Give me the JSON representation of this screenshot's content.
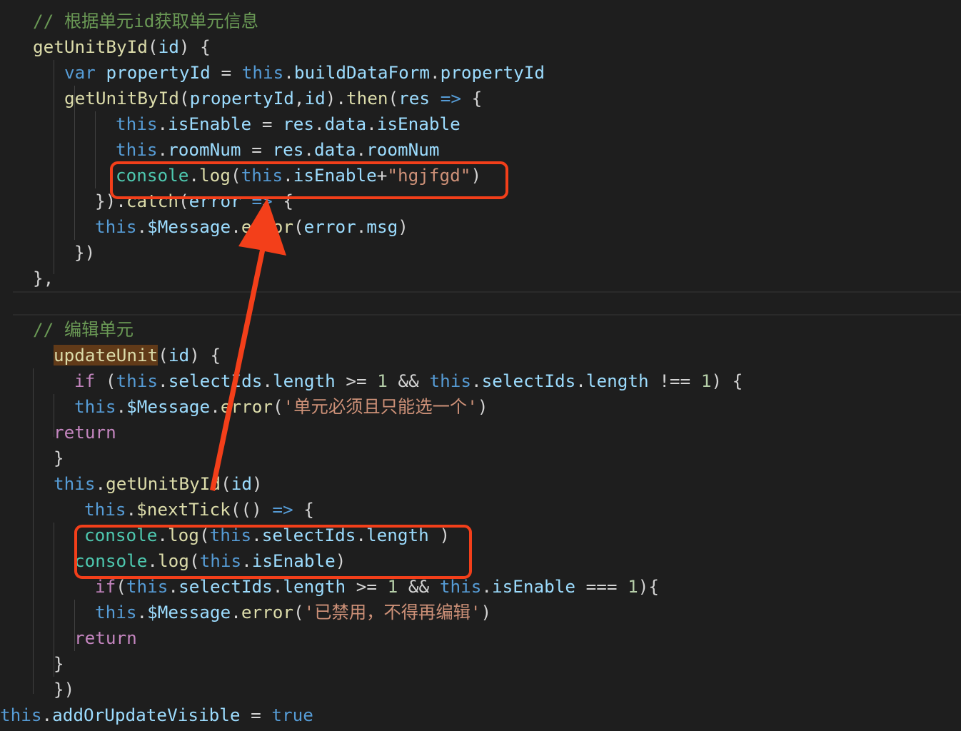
{
  "editor": {
    "colors": {
      "background": "#1e1e1e",
      "comment": "#6a9955",
      "keyword": "#569cd6",
      "control": "#c586c0",
      "function": "#dcdcaa",
      "variable": "#9cdcfe",
      "class": "#4ec9b0",
      "string": "#ce9178",
      "number": "#b5cea8",
      "plain": "#d4d4d4",
      "word_highlight": "#613a18",
      "annotation": "#f33f1a"
    },
    "lines": [
      [
        {
          "t": "// 根据单元id获取单元信息",
          "k": "comment"
        }
      ],
      [
        {
          "t": "getUnitById",
          "k": "function"
        },
        {
          "t": "(",
          "k": "plain"
        },
        {
          "t": "id",
          "k": "variable"
        },
        {
          "t": ") {",
          "k": "plain"
        }
      ],
      [
        {
          "t": "var",
          "k": "keyword"
        },
        {
          "t": " ",
          "k": "plain"
        },
        {
          "t": "propertyId",
          "k": "variable"
        },
        {
          "t": " = ",
          "k": "plain"
        },
        {
          "t": "this",
          "k": "keyword"
        },
        {
          "t": ".",
          "k": "plain"
        },
        {
          "t": "buildDataForm",
          "k": "variable"
        },
        {
          "t": ".",
          "k": "plain"
        },
        {
          "t": "propertyId",
          "k": "variable"
        }
      ],
      [
        {
          "t": "getUnitById",
          "k": "function"
        },
        {
          "t": "(",
          "k": "plain"
        },
        {
          "t": "propertyId",
          "k": "variable"
        },
        {
          "t": ",",
          "k": "plain"
        },
        {
          "t": "id",
          "k": "variable"
        },
        {
          "t": ").",
          "k": "plain"
        },
        {
          "t": "then",
          "k": "function"
        },
        {
          "t": "(",
          "k": "plain"
        },
        {
          "t": "res",
          "k": "variable"
        },
        {
          "t": " ",
          "k": "plain"
        },
        {
          "t": "=>",
          "k": "keyword"
        },
        {
          "t": " {",
          "k": "plain"
        }
      ],
      [
        {
          "t": "this",
          "k": "keyword"
        },
        {
          "t": ".",
          "k": "plain"
        },
        {
          "t": "isEnable",
          "k": "variable"
        },
        {
          "t": " = ",
          "k": "plain"
        },
        {
          "t": "res",
          "k": "variable"
        },
        {
          "t": ".",
          "k": "plain"
        },
        {
          "t": "data",
          "k": "variable"
        },
        {
          "t": ".",
          "k": "plain"
        },
        {
          "t": "isEnable",
          "k": "variable"
        }
      ],
      [
        {
          "t": "this",
          "k": "keyword"
        },
        {
          "t": ".",
          "k": "plain"
        },
        {
          "t": "roomNum",
          "k": "variable"
        },
        {
          "t": " = ",
          "k": "plain"
        },
        {
          "t": "res",
          "k": "variable"
        },
        {
          "t": ".",
          "k": "plain"
        },
        {
          "t": "data",
          "k": "variable"
        },
        {
          "t": ".",
          "k": "plain"
        },
        {
          "t": "roomNum",
          "k": "variable"
        }
      ],
      [
        {
          "t": "console",
          "k": "class"
        },
        {
          "t": ".",
          "k": "plain"
        },
        {
          "t": "log",
          "k": "function"
        },
        {
          "t": "(",
          "k": "plain"
        },
        {
          "t": "this",
          "k": "keyword"
        },
        {
          "t": ".",
          "k": "plain"
        },
        {
          "t": "isEnable",
          "k": "variable"
        },
        {
          "t": "+",
          "k": "plain"
        },
        {
          "t": "\"hgjfgd\"",
          "k": "string"
        },
        {
          "t": ")",
          "k": "plain"
        }
      ],
      [
        {
          "t": "}).",
          "k": "plain"
        },
        {
          "t": "catch",
          "k": "function"
        },
        {
          "t": "(",
          "k": "plain"
        },
        {
          "t": "error",
          "k": "variable"
        },
        {
          "t": " ",
          "k": "plain"
        },
        {
          "t": "=>",
          "k": "keyword"
        },
        {
          "t": " {",
          "k": "plain"
        }
      ],
      [
        {
          "t": "this",
          "k": "keyword"
        },
        {
          "t": ".",
          "k": "plain"
        },
        {
          "t": "$Message",
          "k": "variable"
        },
        {
          "t": ".",
          "k": "plain"
        },
        {
          "t": "error",
          "k": "function"
        },
        {
          "t": "(",
          "k": "plain"
        },
        {
          "t": "error",
          "k": "variable"
        },
        {
          "t": ".",
          "k": "plain"
        },
        {
          "t": "msg",
          "k": "variable"
        },
        {
          "t": ")",
          "k": "plain"
        }
      ],
      [
        {
          "t": "})",
          "k": "plain"
        }
      ],
      [
        {
          "t": "},",
          "k": "plain"
        }
      ],
      [
        {
          "t": "// 编辑单元",
          "k": "comment"
        }
      ],
      [
        {
          "t": "updateUnit",
          "k": "function",
          "hl": true
        },
        {
          "t": "(",
          "k": "plain"
        },
        {
          "t": "id",
          "k": "variable"
        },
        {
          "t": ") {",
          "k": "plain"
        }
      ],
      [
        {
          "t": "if",
          "k": "control"
        },
        {
          "t": " (",
          "k": "plain"
        },
        {
          "t": "this",
          "k": "keyword"
        },
        {
          "t": ".",
          "k": "plain"
        },
        {
          "t": "selectIds",
          "k": "variable"
        },
        {
          "t": ".",
          "k": "plain"
        },
        {
          "t": "length",
          "k": "variable"
        },
        {
          "t": " >= ",
          "k": "plain"
        },
        {
          "t": "1",
          "k": "number"
        },
        {
          "t": " && ",
          "k": "plain"
        },
        {
          "t": "this",
          "k": "keyword"
        },
        {
          "t": ".",
          "k": "plain"
        },
        {
          "t": "selectIds",
          "k": "variable"
        },
        {
          "t": ".",
          "k": "plain"
        },
        {
          "t": "length",
          "k": "variable"
        },
        {
          "t": " !== ",
          "k": "plain"
        },
        {
          "t": "1",
          "k": "number"
        },
        {
          "t": ") {",
          "k": "plain"
        }
      ],
      [
        {
          "t": "this",
          "k": "keyword"
        },
        {
          "t": ".",
          "k": "plain"
        },
        {
          "t": "$Message",
          "k": "variable"
        },
        {
          "t": ".",
          "k": "plain"
        },
        {
          "t": "error",
          "k": "function"
        },
        {
          "t": "(",
          "k": "plain"
        },
        {
          "t": "'单元必须且只能选一个'",
          "k": "string"
        },
        {
          "t": ")",
          "k": "plain"
        }
      ],
      [
        {
          "t": "return",
          "k": "control"
        }
      ],
      [
        {
          "t": "}",
          "k": "plain"
        }
      ],
      [
        {
          "t": "this",
          "k": "keyword"
        },
        {
          "t": ".",
          "k": "plain"
        },
        {
          "t": "getUnitById",
          "k": "function"
        },
        {
          "t": "(",
          "k": "plain"
        },
        {
          "t": "id",
          "k": "variable"
        },
        {
          "t": ")",
          "k": "plain"
        }
      ],
      [
        {
          "t": "this",
          "k": "keyword"
        },
        {
          "t": ".",
          "k": "plain"
        },
        {
          "t": "$nextTick",
          "k": "function"
        },
        {
          "t": "(() ",
          "k": "plain"
        },
        {
          "t": "=>",
          "k": "keyword"
        },
        {
          "t": " {",
          "k": "plain"
        }
      ],
      [
        {
          "t": "console",
          "k": "class"
        },
        {
          "t": ".",
          "k": "plain"
        },
        {
          "t": "log",
          "k": "function"
        },
        {
          "t": "(",
          "k": "plain"
        },
        {
          "t": "this",
          "k": "keyword"
        },
        {
          "t": ".",
          "k": "plain"
        },
        {
          "t": "selectIds",
          "k": "variable"
        },
        {
          "t": ".",
          "k": "plain"
        },
        {
          "t": "length",
          "k": "variable"
        },
        {
          "t": " )",
          "k": "plain"
        }
      ],
      [
        {
          "t": "console",
          "k": "class"
        },
        {
          "t": ".",
          "k": "plain"
        },
        {
          "t": "log",
          "k": "function"
        },
        {
          "t": "(",
          "k": "plain"
        },
        {
          "t": "this",
          "k": "keyword"
        },
        {
          "t": ".",
          "k": "plain"
        },
        {
          "t": "isEnable",
          "k": "variable"
        },
        {
          "t": ")",
          "k": "plain"
        }
      ],
      [
        {
          "t": "if",
          "k": "control"
        },
        {
          "t": "(",
          "k": "plain"
        },
        {
          "t": "this",
          "k": "keyword"
        },
        {
          "t": ".",
          "k": "plain"
        },
        {
          "t": "selectIds",
          "k": "variable"
        },
        {
          "t": ".",
          "k": "plain"
        },
        {
          "t": "length",
          "k": "variable"
        },
        {
          "t": " >= ",
          "k": "plain"
        },
        {
          "t": "1",
          "k": "number"
        },
        {
          "t": " && ",
          "k": "plain"
        },
        {
          "t": "this",
          "k": "keyword"
        },
        {
          "t": ".",
          "k": "plain"
        },
        {
          "t": "isEnable",
          "k": "variable"
        },
        {
          "t": " === ",
          "k": "plain"
        },
        {
          "t": "1",
          "k": "number"
        },
        {
          "t": "){",
          "k": "plain"
        }
      ],
      [
        {
          "t": "this",
          "k": "keyword"
        },
        {
          "t": ".",
          "k": "plain"
        },
        {
          "t": "$Message",
          "k": "variable"
        },
        {
          "t": ".",
          "k": "plain"
        },
        {
          "t": "error",
          "k": "function"
        },
        {
          "t": "(",
          "k": "plain"
        },
        {
          "t": "'已禁用，不得再编辑'",
          "k": "string"
        },
        {
          "t": ")",
          "k": "plain"
        }
      ],
      [
        {
          "t": "return",
          "k": "control"
        }
      ],
      [
        {
          "t": "}",
          "k": "plain"
        }
      ],
      [
        {
          "t": "})",
          "k": "plain"
        }
      ],
      [
        {
          "t": "this",
          "k": "keyword"
        },
        {
          "t": ".",
          "k": "plain"
        },
        {
          "t": "addOrUpdateVisible",
          "k": "variable"
        },
        {
          "t": " = ",
          "k": "plain"
        },
        {
          "t": "true",
          "k": "keyword"
        }
      ]
    ]
  }
}
